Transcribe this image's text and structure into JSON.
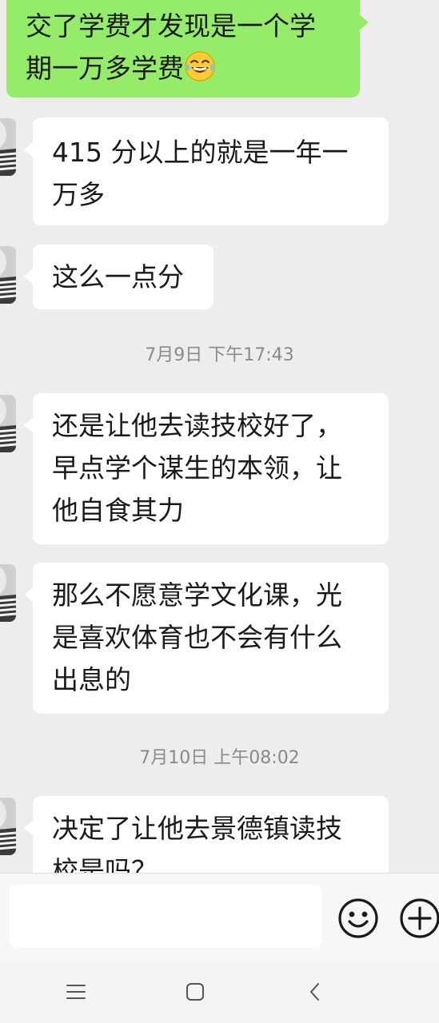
{
  "messages": [
    {
      "side": "me",
      "lines": [
        "交了学费才发现是一个学",
        "期一万多学费"
      ],
      "emoji": "tears-of-joy"
    },
    {
      "side": "them",
      "lines": [
        "415 分以上的就是一年一",
        "万多"
      ]
    },
    {
      "side": "them",
      "lines": [
        "这么一点分"
      ]
    },
    {
      "timestamp": "7月9日 下午17:43"
    },
    {
      "side": "them",
      "lines": [
        "还是让他去读技校好了，",
        "早点学个谋生的本领，让",
        "他自食其力"
      ]
    },
    {
      "side": "them",
      "lines": [
        "那么不愿意学文化课，光",
        "是喜欢体育也不会有什么",
        "出息的"
      ]
    },
    {
      "timestamp": "7月10日 上午08:02"
    },
    {
      "side": "them",
      "lines": [
        "决定了让他去景德镇读技",
        "校是吗？"
      ]
    }
  ],
  "input_bar": {
    "value": "",
    "icons": [
      "emoji-icon",
      "plus-icon"
    ]
  },
  "nav_bar": {
    "icons": [
      "menu-icon",
      "home-icon",
      "back-icon"
    ]
  },
  "colors": {
    "my_bubble": "#95ec69",
    "their_bubble": "#ffffff",
    "chat_background": "#ededed"
  }
}
